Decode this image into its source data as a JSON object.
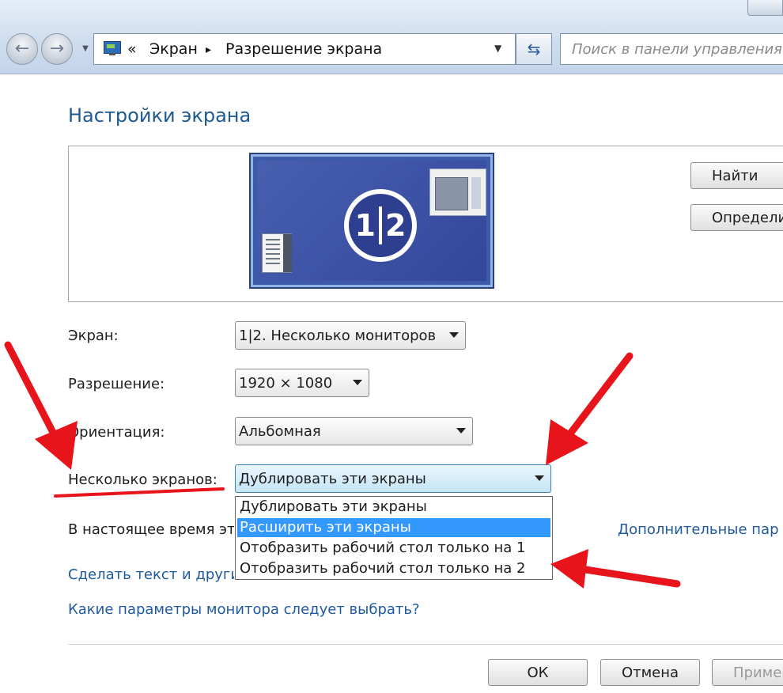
{
  "breadcrumb": {
    "prefix": "«",
    "item1": "Экран",
    "separator": "▸",
    "item2": "Разрешение экрана"
  },
  "search": {
    "placeholder": "Поиск в панели управления"
  },
  "page": {
    "title": "Настройки экрана"
  },
  "preview": {
    "display1": "1",
    "display2": "2"
  },
  "right_buttons": {
    "find": "Найти",
    "identify": "Определи"
  },
  "fields": {
    "screen": {
      "label": "Экран:",
      "value": "1|2. Несколько мониторов"
    },
    "resolution": {
      "label": "Разрешение:",
      "value": "1920 × 1080"
    },
    "orientation": {
      "label": "Ориентация:",
      "value": "Альбомная"
    },
    "multiple": {
      "label": "Несколько экранов:",
      "value": "Дублировать эти экраны",
      "options": [
        "Дублировать эти экраны",
        "Расширить эти экраны",
        "Отобразить рабочий стол только на 1",
        "Отобразить рабочий стол только на 2"
      ],
      "highlighted_index": 1
    }
  },
  "status_text": "В настоящее время эт",
  "links": {
    "advanced": "Дополнительные пар",
    "text_size": "Сделать текст и другие",
    "which_params": "Какие параметры монитора следует выбрать?"
  },
  "footer": {
    "ok": "ОК",
    "cancel": "Отмена",
    "apply": "Приме"
  },
  "colors": {
    "annotation_arrow": "#e8141c",
    "title": "#1e5a8e",
    "link": "#1f5aa0",
    "highlight": "#3399ff"
  },
  "icons": [
    "back-arrow-icon",
    "forward-arrow-icon",
    "control-panel-display-icon",
    "refresh-icon",
    "chevron-down-icon"
  ]
}
